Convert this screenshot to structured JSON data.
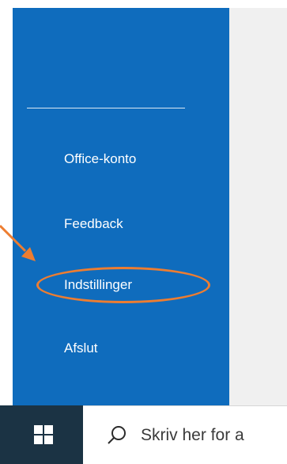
{
  "menu": {
    "items": [
      {
        "label": "Office-konto"
      },
      {
        "label": "Feedback"
      },
      {
        "label": "Indstillinger"
      },
      {
        "label": "Afslut"
      }
    ]
  },
  "taskbar": {
    "search_text": "Skriv her for a"
  },
  "icons": {
    "start": "windows-logo-icon",
    "search": "search-icon"
  },
  "colors": {
    "panel_background": "#0f6cbd",
    "highlight": "#ed7d31",
    "taskbar_start": "#1b3344"
  }
}
